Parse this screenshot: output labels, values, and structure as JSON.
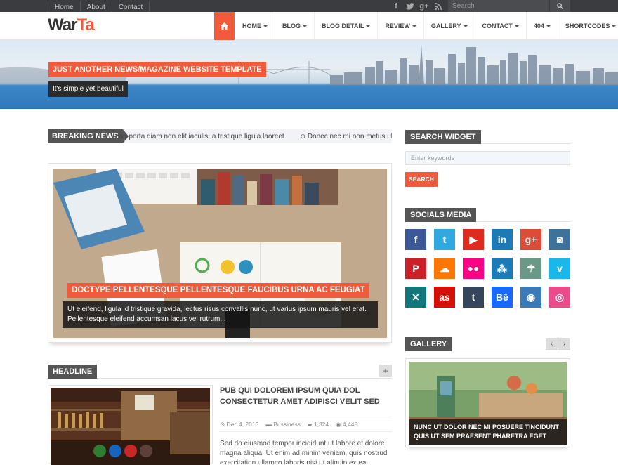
{
  "topbar": {
    "links": [
      "Home",
      "About",
      "Contact"
    ],
    "social_icons": [
      "facebook-icon",
      "twitter-icon",
      "google-plus-icon",
      "rss-icon"
    ],
    "search_placeholder": "Search"
  },
  "header": {
    "logo_part1": "War",
    "logo_part2": "Ta",
    "nav": [
      "HOME",
      "BLOG",
      "BLOG DETAIL",
      "REVIEW",
      "GALLERY",
      "CONTACT",
      "404",
      "SHORTCODES"
    ]
  },
  "banner": {
    "tagline": "JUST ANOTHER NEWS/MAGAZINE WEBSITE TEMPLATE",
    "subtagline": "It's simple yet beautiful"
  },
  "breaking": {
    "label": "BREAKING NEWS",
    "text1": "ean porta diam non elit iaculis, a tristique ligula laoreet",
    "text2": "Donec nec mi non metus ullamco"
  },
  "feature": {
    "title": "DOCTYPE PELLENTESQUE PELLENTESQUE FAUCIBUS URNA AC FEUGIAT",
    "description": "Ut eleifend, ligula id tristique gravida, lectus risus convallis nunc, ut varius ipsum mauris vel erat. Pellentesque eleifend accumsan lacus vel rutrum..."
  },
  "headline": {
    "label": "HEADLINE",
    "post_title": "PUB QUI DOLOREM IPSUM QUIA DOL CONSECTETUR AMET ADIPISCI VELIT SED",
    "date": "Dec 4, 2013",
    "category": "Bussiness",
    "comments": "1,324",
    "views": "4,448",
    "excerpt": "Sed do eiusmod tempor incididunt ut labore et dolore magna aliqua. Ut enim ad minim veniam, quis nostrud exercitation ullamco laboris nisi ut aliquip ex ea"
  },
  "sidebar": {
    "search_title": "SEARCH WIDGET",
    "search_placeholder": "Enter keywords",
    "search_button": "SEARCH",
    "socials_title": "SOCIALS MEDIA",
    "socials": [
      {
        "name": "facebook-icon",
        "glyph": "f",
        "color": "#3b5998"
      },
      {
        "name": "twitter-icon",
        "glyph": "t",
        "color": "#2fa9e0"
      },
      {
        "name": "youtube-icon",
        "glyph": "▶",
        "color": "#e02a20"
      },
      {
        "name": "linkedin-icon",
        "glyph": "in",
        "color": "#1c7ab6"
      },
      {
        "name": "google-plus-icon",
        "glyph": "g+",
        "color": "#dd4b39"
      },
      {
        "name": "instagram-icon",
        "glyph": "◙",
        "color": "#3f729b"
      },
      {
        "name": "pinterest-icon",
        "glyph": "P",
        "color": "#cb2027"
      },
      {
        "name": "soundcloud-icon",
        "glyph": "☁",
        "color": "#ff7700"
      },
      {
        "name": "flickr-icon",
        "glyph": "●●",
        "color": "#ff0084"
      },
      {
        "name": "myspace-icon",
        "glyph": "⁂",
        "color": "#1c7ab6"
      },
      {
        "name": "delicious-icon",
        "glyph": "☂",
        "color": "#6b9988"
      },
      {
        "name": "vimeo-icon",
        "glyph": "v",
        "color": "#1ab7ea"
      },
      {
        "name": "xing-icon",
        "glyph": "✕",
        "color": "#11777a"
      },
      {
        "name": "lastfm-icon",
        "glyph": "as",
        "color": "#d51007"
      },
      {
        "name": "tumblr-icon",
        "glyph": "t",
        "color": "#35465c"
      },
      {
        "name": "behance-icon",
        "glyph": "Bē",
        "color": "#1769ff"
      },
      {
        "name": "github-icon",
        "glyph": "◉",
        "color": "#3a7ab8"
      },
      {
        "name": "dribbble-icon",
        "glyph": "◎",
        "color": "#ea4c89"
      }
    ],
    "gallery_title": "GALLERY",
    "gallery_caption": "NUNC UT DOLOR NEC MI POSUERE TINCIDUNT QUIS UT SEM PRAESENT PHARETRA EGET"
  },
  "colors": {
    "accent": "#f15a3a",
    "dark": "#555555",
    "topbar": "#3a3c3f"
  }
}
